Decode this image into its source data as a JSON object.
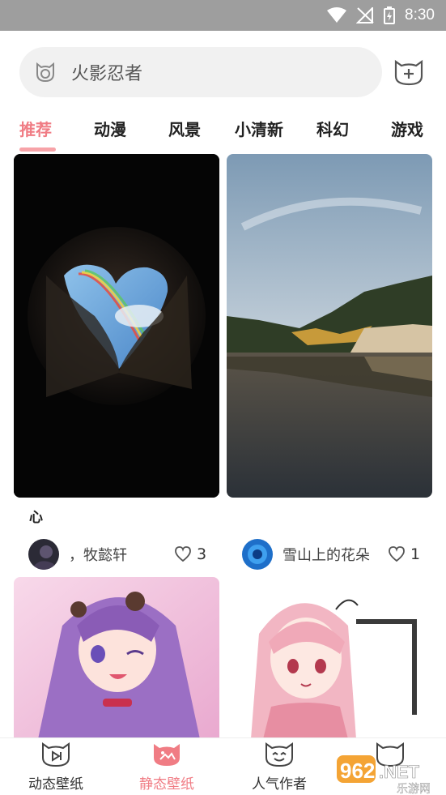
{
  "status_bar": {
    "time": "8:30"
  },
  "search": {
    "placeholder_text": "火影忍者"
  },
  "tabs": [
    {
      "label": "推荐",
      "active": true
    },
    {
      "label": "动漫",
      "active": false
    },
    {
      "label": "风景",
      "active": false
    },
    {
      "label": "小清新",
      "active": false
    },
    {
      "label": "科幻",
      "active": false
    },
    {
      "label": "游戏",
      "active": false
    }
  ],
  "cards": [
    {
      "title": "心",
      "author": "，牧懿轩",
      "likes": "3"
    },
    {
      "title": "",
      "author": "雪山上的花朵",
      "likes": "1"
    }
  ],
  "bottom_nav": [
    {
      "label": "动态壁纸",
      "icon": "play-cat-icon",
      "active": false
    },
    {
      "label": "静态壁纸",
      "icon": "image-cat-icon",
      "active": true
    },
    {
      "label": "人气作者",
      "icon": "smile-cat-icon",
      "active": false
    },
    {
      "label": "",
      "icon": "cat-icon",
      "active": false
    }
  ],
  "watermark": {
    "text": "962.NET",
    "subtext": "乐游网"
  },
  "colors": {
    "accent": "#f07c84",
    "status_bar": "#9e9e9e",
    "search_bg": "#f1f1f1"
  }
}
